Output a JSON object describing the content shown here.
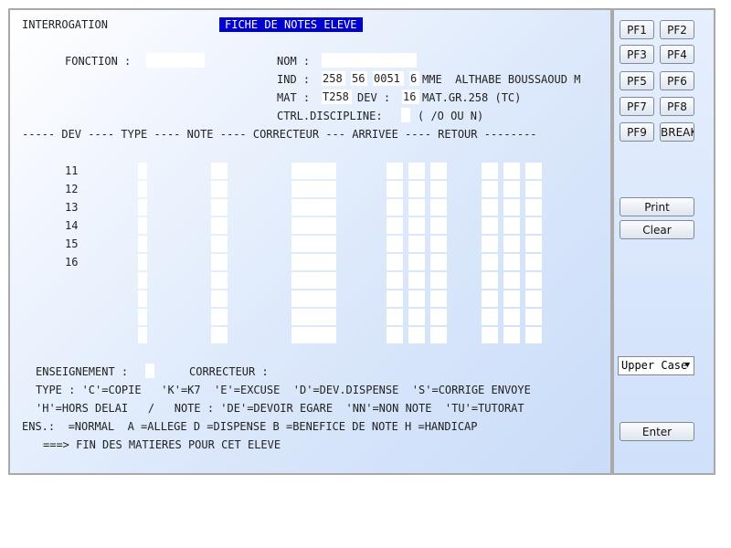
{
  "header": {
    "interrogation": "INTERROGATION",
    "screen_title": "FICHE DE NOTES ELEVE"
  },
  "form": {
    "fonction_label": "FONCTION :",
    "fonction_value": "",
    "nom_label": "NOM :",
    "nom_value": "",
    "ind_label": "IND :",
    "ind_part1": "258",
    "ind_part2": "56",
    "ind_part3": "0051",
    "ind_part4": "6",
    "ind_name": "MME  ALTHABE BOUSSAOUD M",
    "mat_label": "MAT :",
    "mat_value": "T258",
    "dev_label": "DEV :",
    "dev_value": "16",
    "mat_desc": "MAT.GR.258 (TC)",
    "ctrl_label": "CTRL.DISCIPLINE:",
    "ctrl_value": "",
    "ctrl_hint": "( /O OU N)"
  },
  "table": {
    "header_line": "----- DEV ---- TYPE ---- NOTE ---- CORRECTEUR --- ARRIVEE ---- RETOUR --------",
    "rows": [
      "11",
      "12",
      "13",
      "14",
      "15",
      "16",
      "",
      "",
      "",
      ""
    ]
  },
  "footer": {
    "enseignement_label": "ENSEIGNEMENT :",
    "correcteur_label": "CORRECTEUR :",
    "type_line": "TYPE : 'C'=COPIE   'K'=K7  'E'=EXCUSE  'D'=DEV.DISPENSE  'S'=CORRIGE ENVOYE",
    "h_line": "'H'=HORS DELAI   /   NOTE : 'DE'=DEVOIR EGARE  'NN'=NON NOTE  'TU'=TUTORAT",
    "ens_line": "ENS.:  =NORMAL  A =ALLEGE D =DISPENSE B =BENEFICE DE NOTE H =HANDICAP",
    "fin_line": "===> FIN DES MATIERES POUR CET ELEVE"
  },
  "side": {
    "pf": [
      "PF1",
      "PF2",
      "PF3",
      "PF4",
      "PF5",
      "PF6",
      "PF7",
      "PF8",
      "PF9",
      "BREAK"
    ],
    "print": "Print",
    "clear": "Clear",
    "case_select": "Upper Case",
    "enter": "Enter"
  }
}
